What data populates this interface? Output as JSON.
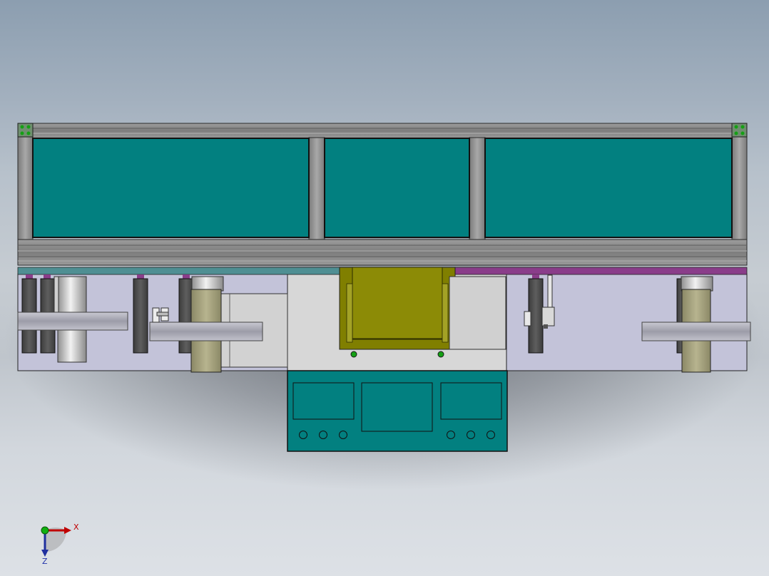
{
  "viewport": {
    "background_top": "#8c9eb0",
    "background_bottom": "#dde1e6"
  },
  "colors": {
    "panel_teal": "#028080",
    "frame_gray": "#8d8d8d",
    "frame_dark": "#6f6f6f",
    "body_lavender": "#c3c3d9",
    "base_light": "#d7d7d7",
    "stripe_teal": "#4f8f93",
    "stripe_purple": "#8a3d8a",
    "olive": "#807f00",
    "roller_dark": "#4b4b4b",
    "khaki": "#a6a37f",
    "belt": "#a9a9b4",
    "connector_green": "#14a014"
  },
  "triad": {
    "x_label": "X",
    "z_label": "Z",
    "icons": [
      "axis-x-arrow-icon",
      "axis-y-dot-icon",
      "axis-z-arrow-icon"
    ]
  }
}
